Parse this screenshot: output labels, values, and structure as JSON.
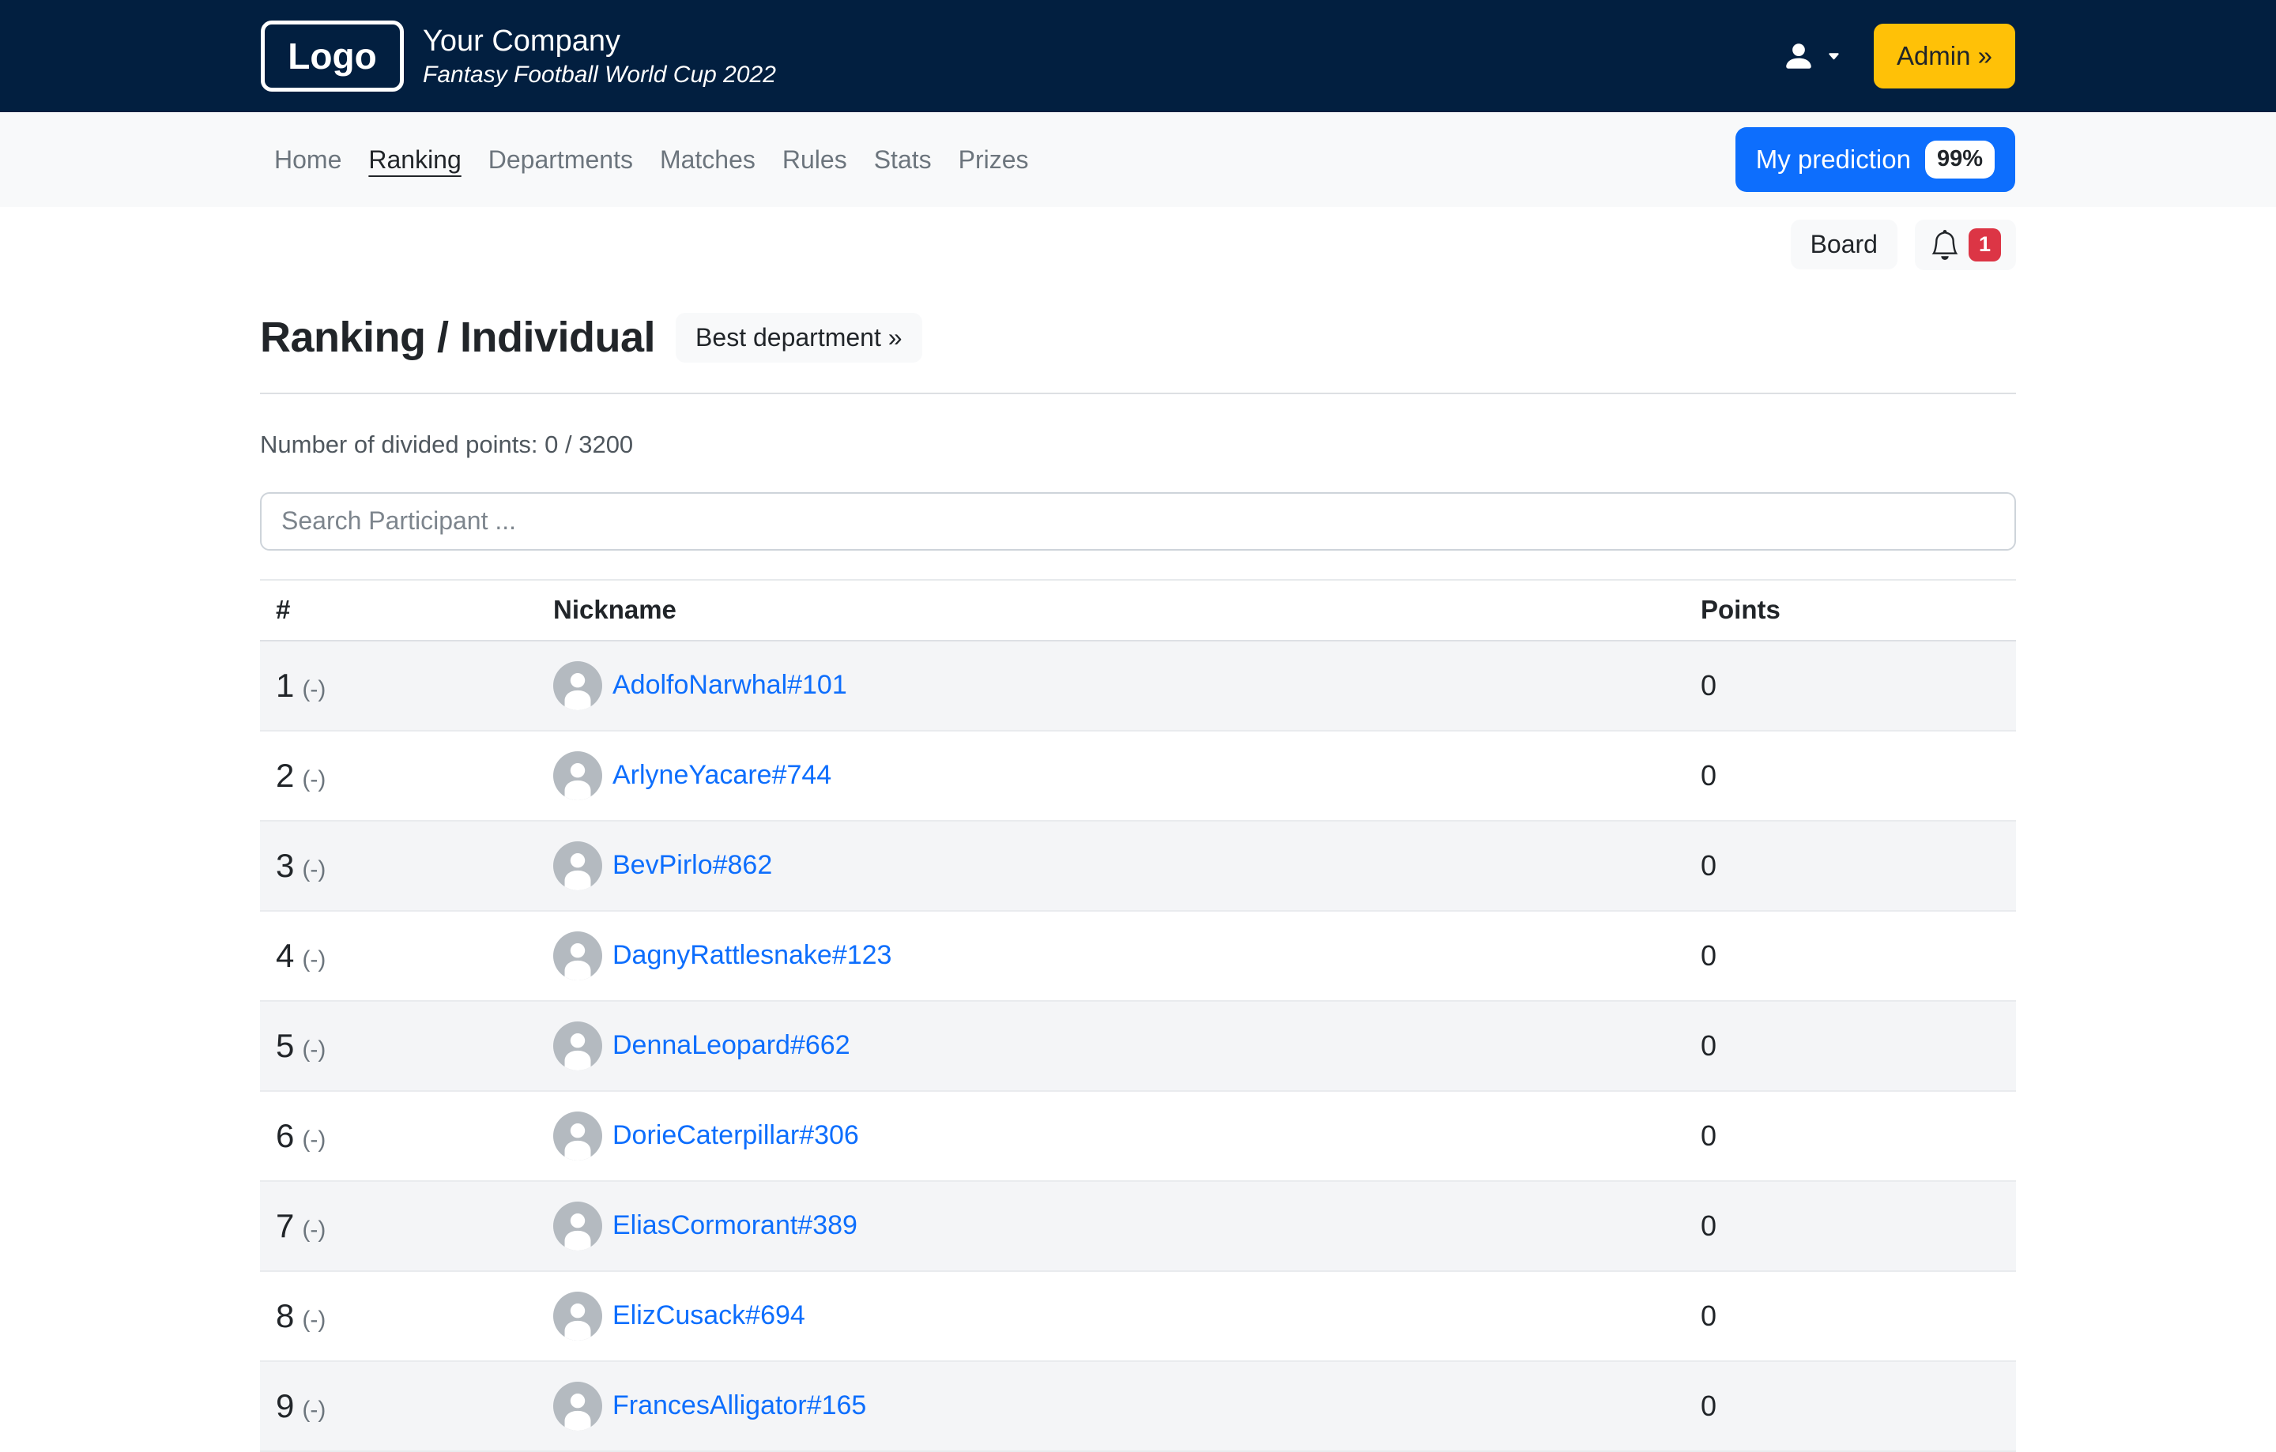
{
  "colors": {
    "header-bg": "#021f40",
    "accent-blue": "#0d6efd",
    "accent-yellow": "#ffc107",
    "accent-red": "#dc3545",
    "link-blue": "#0d6efd"
  },
  "header": {
    "logo": "Logo",
    "company": "Your Company",
    "subtitle": "Fantasy Football World Cup 2022",
    "admin_button": "Admin »"
  },
  "nav": {
    "items": [
      {
        "label": "Home",
        "active": false
      },
      {
        "label": "Ranking",
        "active": true
      },
      {
        "label": "Departments",
        "active": false
      },
      {
        "label": "Matches",
        "active": false
      },
      {
        "label": "Rules",
        "active": false
      },
      {
        "label": "Stats",
        "active": false
      },
      {
        "label": "Prizes",
        "active": false
      }
    ],
    "prediction_button": {
      "label": "My prediction",
      "badge": "99%"
    }
  },
  "toolbar": {
    "board_button": "Board",
    "notifications_count": "1"
  },
  "page": {
    "title": "Ranking / Individual",
    "best_department_button": "Best department »",
    "divided_points": "Number of divided points: 0 / 3200",
    "search_placeholder": "Search Participant ..."
  },
  "table": {
    "headers": {
      "rank": "#",
      "nickname": "Nickname",
      "points": "Points"
    },
    "rows": [
      {
        "rank": "1",
        "trend": "(-)",
        "nickname": "AdolfoNarwhal#101",
        "points": "0"
      },
      {
        "rank": "2",
        "trend": "(-)",
        "nickname": "ArlyneYacare#744",
        "points": "0"
      },
      {
        "rank": "3",
        "trend": "(-)",
        "nickname": "BevPirlo#862",
        "points": "0"
      },
      {
        "rank": "4",
        "trend": "(-)",
        "nickname": "DagnyRattlesnake#123",
        "points": "0"
      },
      {
        "rank": "5",
        "trend": "(-)",
        "nickname": "DennaLeopard#662",
        "points": "0"
      },
      {
        "rank": "6",
        "trend": "(-)",
        "nickname": "DorieCaterpillar#306",
        "points": "0"
      },
      {
        "rank": "7",
        "trend": "(-)",
        "nickname": "EliasCormorant#389",
        "points": "0"
      },
      {
        "rank": "8",
        "trend": "(-)",
        "nickname": "ElizCusack#694",
        "points": "0"
      },
      {
        "rank": "9",
        "trend": "(-)",
        "nickname": "FrancesAlligator#165",
        "points": "0"
      }
    ]
  }
}
